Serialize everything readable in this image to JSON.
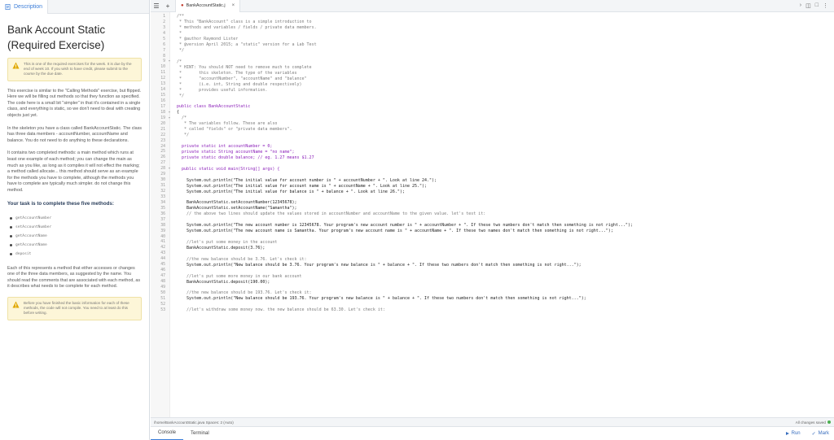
{
  "left": {
    "tab_label": "Description",
    "title": "Bank Account Static (Required Exercise)",
    "warning_top": "This is one of the required exercises for the week. It is due by the end of week 10. If you wish to have credit, please submit to the course by the due date.",
    "paragraphs": [
      "This exercise is similar to the \"Calling Methods\" exercise, but flipped. Here we will be filling out methods so that they function as specified. The code here is a small bit \"simpler\" in that it's contained in a single class, and everything is static, so we don't need to deal with creating objects just yet.",
      "In the skeleton you have a class called BankAccountStatic. The class has three data members - accountNumber, accountName and balance. You do not need to do anything to these declarations.",
      "It contains two completed methods: a main method which runs at least one example of each method; you can change the main as much as you like, as long as it compiles it will not effect the marking; a method called allocate... this method should serve as an example for the methods you have to complete, although the methods you have to complete are typically much simpler. do not change this method."
    ],
    "task_heading": "Your task is to complete these five methods:",
    "methods": [
      "getAccountNumber",
      "setAccountNumber",
      "getAccountName",
      "getAccountName",
      "deposit"
    ],
    "paragraph_after": "Each of this represents a method that either accesses or changes one of the three data members, as suggested by the name. You should read the comments that are associated with each method, as it describes what needs to be complete for each method.",
    "warning_bottom": "Before you have finished the basic information for each of these methods, the code will not compile. You need to at least do this before writing."
  },
  "editor": {
    "file_tab": "BankAccountStatic.j",
    "status_path": "/home/BankAccountStatic.java  Spaces: 2 (Auto)",
    "status_right": "All changes saved",
    "bottom_tabs": [
      "Console",
      "Terminal"
    ],
    "run_label": "Run",
    "mark_label": "Mark",
    "lines": [
      {
        "n": "1",
        "f": "",
        "k": "cm",
        "t": "/**"
      },
      {
        "n": "2",
        "f": "",
        "k": "cm",
        "t": " * This \"BankAccount\" class is a simple introduction to"
      },
      {
        "n": "3",
        "f": "",
        "k": "cm",
        "t": " * methods and variables / fields / private data members."
      },
      {
        "n": "4",
        "f": "",
        "k": "cm",
        "t": " *"
      },
      {
        "n": "5",
        "f": "",
        "k": "cm",
        "t": " * @author Raymond Lister"
      },
      {
        "n": "6",
        "f": "",
        "k": "cm",
        "t": " * @version April 2015; a \"static\" version for a Lab Test"
      },
      {
        "n": "7",
        "f": "",
        "k": "cm",
        "t": " */"
      },
      {
        "n": "8",
        "f": "",
        "k": "cd",
        "t": ""
      },
      {
        "n": "9",
        "f": "▾",
        "k": "cm",
        "t": "/*"
      },
      {
        "n": "10",
        "f": "",
        "k": "cm",
        "t": " * HINT: You should NOT need to remove much to complete"
      },
      {
        "n": "11",
        "f": "",
        "k": "cm",
        "t": " *       this skeleton. The type of the variables"
      },
      {
        "n": "12",
        "f": "",
        "k": "cm",
        "t": " *       \"accountNumber\", \"accountName\" and \"balance\""
      },
      {
        "n": "13",
        "f": "",
        "k": "cm",
        "t": " *       (i.e. int, String and double respectively)"
      },
      {
        "n": "14",
        "f": "",
        "k": "cm",
        "t": " *       provides useful information."
      },
      {
        "n": "15",
        "f": "",
        "k": "cm",
        "t": " */"
      },
      {
        "n": "16",
        "f": "",
        "k": "cd",
        "t": ""
      },
      {
        "n": "17",
        "f": "",
        "k": "kw",
        "t": "public class BankAccountStatic"
      },
      {
        "n": "18",
        "f": "▾",
        "k": "cd",
        "t": "{"
      },
      {
        "n": "19",
        "f": "▾",
        "k": "cm",
        "t": "  /*"
      },
      {
        "n": "20",
        "f": "",
        "k": "cm",
        "t": "   * The variables follow. These are also"
      },
      {
        "n": "21",
        "f": "",
        "k": "cm",
        "t": "   * called \"fields\" or \"private data members\"."
      },
      {
        "n": "22",
        "f": "",
        "k": "cm",
        "t": "   */"
      },
      {
        "n": "23",
        "f": "",
        "k": "cd",
        "t": ""
      },
      {
        "n": "24",
        "f": "",
        "k": "kw",
        "t": "  private static int accountNumber = 0;"
      },
      {
        "n": "25",
        "f": "",
        "k": "kw",
        "t": "  private static String accountName = \"no name\";"
      },
      {
        "n": "26",
        "f": "",
        "k": "kw",
        "t": "  private static double balance; // eg. 1.27 means $1.27"
      },
      {
        "n": "27",
        "f": "",
        "k": "cd",
        "t": ""
      },
      {
        "n": "28",
        "f": "▾",
        "k": "kw",
        "t": "  public static void main(String[] args) {"
      },
      {
        "n": "29",
        "f": "",
        "k": "cd",
        "t": ""
      },
      {
        "n": "30",
        "f": "",
        "k": "cd",
        "t": "    System.out.println(\"The initial value for account number is \" + accountNumber + \". Look at line 24.\");"
      },
      {
        "n": "31",
        "f": "",
        "k": "cd",
        "t": "    System.out.println(\"The initial value for account name is \" + accountName + \". Look at line 25.\");"
      },
      {
        "n": "32",
        "f": "",
        "k": "cd",
        "t": "    System.out.println(\"The initial value for balance is \" + balance + \". Look at line 26.\");"
      },
      {
        "n": "33",
        "f": "",
        "k": "cd",
        "t": ""
      },
      {
        "n": "34",
        "f": "",
        "k": "cd",
        "t": "    BankAccountStatic.setAccountNumber(12345678);"
      },
      {
        "n": "35",
        "f": "",
        "k": "cd",
        "t": "    BankAccountStatic.setAccountName(\"Samantha\");"
      },
      {
        "n": "36",
        "f": "",
        "k": "cm",
        "t": "    // the above two lines should update the values stored in accountNumber and accountName to the given value. let's test it:"
      },
      {
        "n": "37",
        "f": "",
        "k": "cd",
        "t": ""
      },
      {
        "n": "38",
        "f": "",
        "k": "cd",
        "t": "    System.out.println(\"The new account number is 12345678. Your program's new account number is \" + accountNumber + \". If these two numbers don't match then something is not right...\");"
      },
      {
        "n": "39",
        "f": "",
        "k": "cd",
        "t": "    System.out.println(\"The new account name is Samantha. Your program's new account name is \" + accountName + \". If these two names don't match then something is not right...\");"
      },
      {
        "n": "40",
        "f": "",
        "k": "cd",
        "t": ""
      },
      {
        "n": "41",
        "f": "",
        "k": "cm",
        "t": "    //let's put some money in the account"
      },
      {
        "n": "42",
        "f": "",
        "k": "cd",
        "t": "    BankAccountStatic.deposit(3.76);"
      },
      {
        "n": "43",
        "f": "",
        "k": "cd",
        "t": ""
      },
      {
        "n": "44",
        "f": "",
        "k": "cm",
        "t": "    //the new balance should be 3.76. Let's check it:"
      },
      {
        "n": "45",
        "f": "",
        "k": "cd",
        "t": "    System.out.println(\"New balance should be 3.76. Your program's new balance is \" + balance + \". If these two numbers don't match then something is not right...\");"
      },
      {
        "n": "46",
        "f": "",
        "k": "cd",
        "t": ""
      },
      {
        "n": "47",
        "f": "",
        "k": "cm",
        "t": "    //let's put some more money in our bank account"
      },
      {
        "n": "48",
        "f": "",
        "k": "cd",
        "t": "    BankAccountStatic.deposit(190.00);"
      },
      {
        "n": "49",
        "f": "",
        "k": "cd",
        "t": ""
      },
      {
        "n": "50",
        "f": "",
        "k": "cm",
        "t": "    //the new balance should be 193.76. Let's check it:"
      },
      {
        "n": "51",
        "f": "",
        "k": "cd",
        "t": "    System.out.println(\"New balance should be 193.76. Your program's new balance is \" + balance + \". If these two numbers don't match then something is not right...\");"
      },
      {
        "n": "52",
        "f": "",
        "k": "cd",
        "t": ""
      },
      {
        "n": "53",
        "f": "",
        "k": "cm",
        "t": "    //let's withdraw some money now. the new balance should be 63.30. Let's check it:"
      }
    ]
  }
}
